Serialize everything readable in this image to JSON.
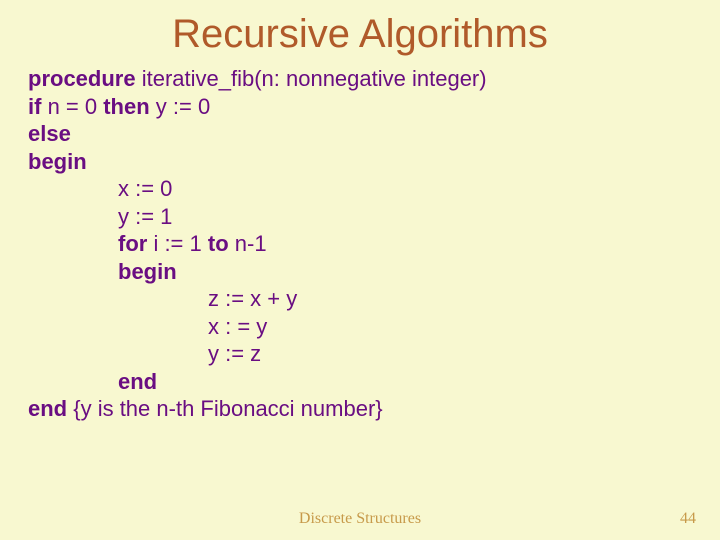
{
  "title": "Recursive Algorithms",
  "code": {
    "l1_kw": "procedure",
    "l1_rest": " iterative_fib(n: nonnegative integer)",
    "l2_kw1": "if",
    "l2_mid": " n = 0 ",
    "l2_kw2": "then",
    "l2_rest": " y := 0",
    "l3": "else",
    "l4": "begin",
    "l5": "x := 0",
    "l6": "y := 1",
    "l7_kw1": "for",
    "l7_mid": " i := 1 ",
    "l7_kw2": "to",
    "l7_rest": " n-1",
    "l8": "begin",
    "l9": "z := x + y",
    "l10": "x : = y",
    "l11": "y := z",
    "l12": "end",
    "l13_kw": "end",
    "l13_rest": "   {y is the n-th Fibonacci number}"
  },
  "footer_center": "Discrete Structures",
  "footer_right": "44"
}
